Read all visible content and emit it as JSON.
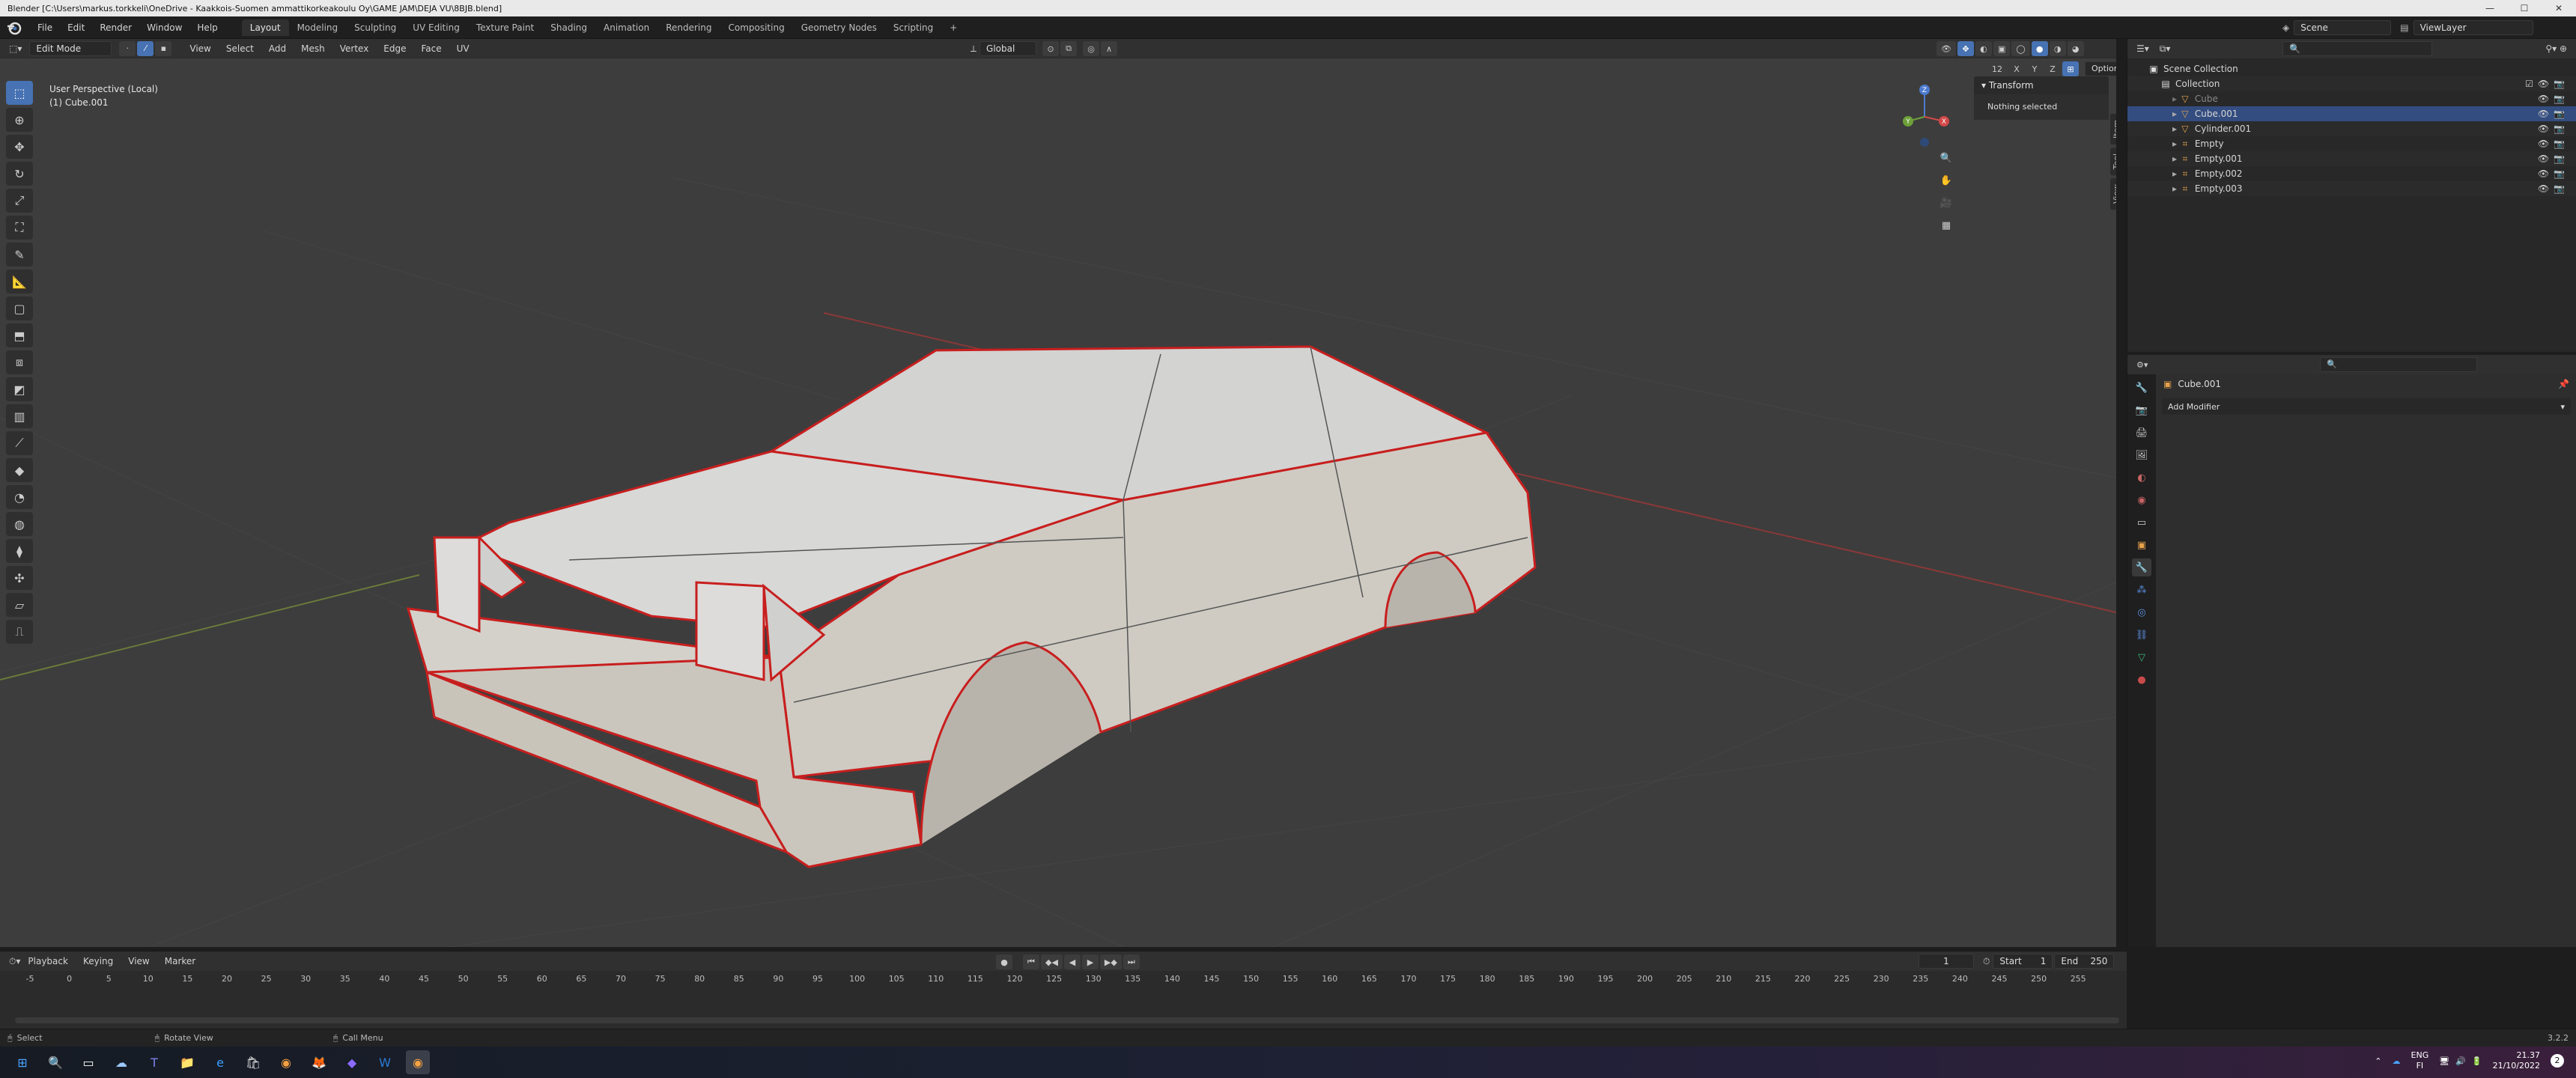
{
  "window": {
    "title": "Blender [C:\\Users\\markus.torkkeli\\OneDrive - Kaakkois-Suomen ammattikorkeakoulu Oy\\GAME JAM\\DEJA VU\\8BJB.blend]",
    "minimize": "—",
    "maximize": "☐",
    "close": "✕"
  },
  "menu": [
    "File",
    "Edit",
    "Render",
    "Window",
    "Help"
  ],
  "workspaces": [
    "Layout",
    "Modeling",
    "Sculpting",
    "UV Editing",
    "Texture Paint",
    "Shading",
    "Animation",
    "Rendering",
    "Compositing",
    "Geometry Nodes",
    "Scripting"
  ],
  "workspace_add": "+",
  "scene": {
    "name": "Scene",
    "view_layer": "ViewLayer"
  },
  "viewport": {
    "mode": "Edit Mode",
    "menus": [
      "View",
      "Select",
      "Add",
      "Mesh",
      "Vertex",
      "Edge",
      "Face",
      "UV"
    ],
    "transform_orientation": "Global",
    "options_label": "Options",
    "info_line1": "User Perspective (Local)",
    "info_line2": "(1) Cube.001",
    "n_panel": {
      "header": "Transform",
      "body": "Nothing selected"
    },
    "n_tabs": [
      "Item",
      "Tool",
      "View"
    ],
    "gizmo": {
      "x": "X",
      "y": "Y",
      "z": "Z"
    },
    "header_counter": "12"
  },
  "outliner": {
    "title": "Scene Collection",
    "rows": [
      {
        "label": "Collection",
        "indent": 1,
        "icon": "collection-icon"
      },
      {
        "label": "Cube",
        "indent": 2,
        "icon": "mesh-icon",
        "dim": true
      },
      {
        "label": "Cube.001",
        "indent": 2,
        "icon": "mesh-icon",
        "selected": true
      },
      {
        "label": "Cylinder.001",
        "indent": 2,
        "icon": "mesh-icon"
      },
      {
        "label": "Empty",
        "indent": 2,
        "icon": "empty-icon"
      },
      {
        "label": "Empty.001",
        "indent": 2,
        "icon": "empty-icon"
      },
      {
        "label": "Empty.002",
        "indent": 2,
        "icon": "empty-icon"
      },
      {
        "label": "Empty.003",
        "indent": 2,
        "icon": "empty-icon"
      }
    ]
  },
  "properties": {
    "object_name": "Cube.001",
    "add_modifier": "Add Modifier"
  },
  "timeline": {
    "menus": [
      "Playback",
      "Keying",
      "View",
      "Marker"
    ],
    "current_frame": "1",
    "start_label": "Start",
    "start": "1",
    "end_label": "End",
    "end": "250",
    "ticks": [
      "-5",
      "0",
      "5",
      "10",
      "15",
      "20",
      "25",
      "30",
      "35",
      "40",
      "45",
      "50",
      "55",
      "60",
      "65",
      "70",
      "75",
      "80",
      "85",
      "90",
      "95",
      "100",
      "105",
      "110",
      "115",
      "120",
      "125",
      "130",
      "135",
      "140",
      "145",
      "150",
      "155",
      "160",
      "165",
      "170",
      "175",
      "180",
      "185",
      "190",
      "195",
      "200",
      "205",
      "210",
      "215",
      "220",
      "225",
      "230",
      "235",
      "240",
      "245",
      "250",
      "255"
    ],
    "playhead": "1"
  },
  "statusbar": {
    "select": "Select",
    "rotate": "Rotate View",
    "call_menu": "Call Menu",
    "version": "3.2.2"
  },
  "taskbar": {
    "lang": "ENG",
    "lang2": "FI",
    "time": "21.37",
    "date": "21/10/2022",
    "notif": "2"
  },
  "colors": {
    "accent": "#4772b3",
    "edge": "#c81e1e",
    "viewport_bg": "#3d3d3d"
  }
}
